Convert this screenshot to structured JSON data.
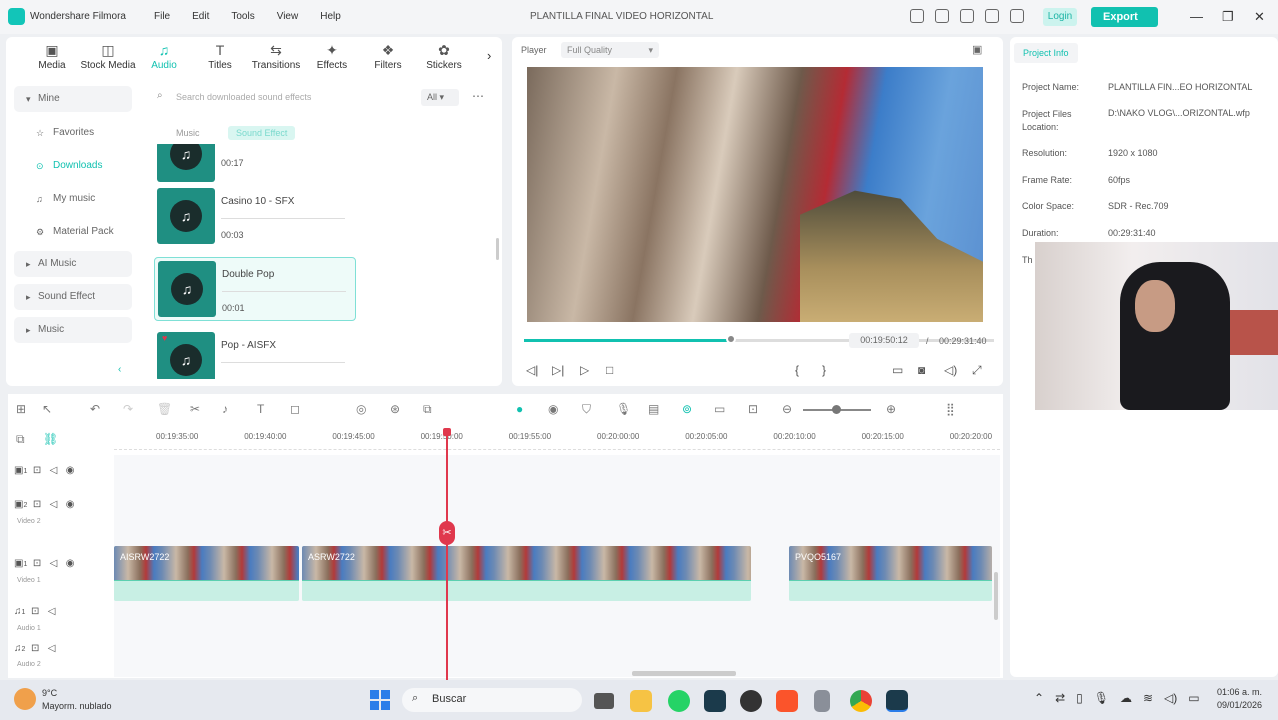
{
  "app": {
    "name": "Wondershare Filmora",
    "project_title": "PLANTILLA FINAL VIDEO HORIZONTAL",
    "login": "Login",
    "export": "Export"
  },
  "menu": [
    "File",
    "Edit",
    "Tools",
    "View",
    "Help"
  ],
  "tabs": [
    {
      "label": "Media",
      "icon": "media-icon"
    },
    {
      "label": "Stock Media",
      "icon": "stock-media-icon"
    },
    {
      "label": "Audio",
      "icon": "audio-icon"
    },
    {
      "label": "Titles",
      "icon": "titles-icon"
    },
    {
      "label": "Transitions",
      "icon": "transitions-icon"
    },
    {
      "label": "Effects",
      "icon": "effects-icon"
    },
    {
      "label": "Filters",
      "icon": "filters-icon"
    },
    {
      "label": "Stickers",
      "icon": "stickers-icon"
    }
  ],
  "sidebar": {
    "head": "Mine",
    "items": [
      "Favorites",
      "Downloads",
      "My music",
      "Material Pack"
    ],
    "sections": [
      "AI Music",
      "Sound Effect",
      "Music"
    ]
  },
  "search": {
    "placeholder": "Search downloaded sound effects",
    "filter": "All"
  },
  "subtabs": [
    "Music",
    "Sound Effect"
  ],
  "sounds": [
    {
      "name": "",
      "duration": "00:17"
    },
    {
      "name": "Casino 10 - SFX",
      "duration": "00:03"
    },
    {
      "name": "Double Pop",
      "duration": "00:01"
    },
    {
      "name": "Pop - AISFX",
      "duration": "00:01"
    }
  ],
  "player": {
    "label": "Player",
    "quality": "Full Quality",
    "current": "00:19:50:12",
    "total": "00:29:31:40",
    "sep": "/",
    "progress": 0.44
  },
  "project_info": {
    "tab": "Project Info",
    "rows": [
      {
        "k": "Project Name:",
        "v": "PLANTILLA FIN...EO HORIZONTAL"
      },
      {
        "k": "Project Files Location:",
        "v": "D:\\NAKO VLOG\\...ORIZONTAL.wfp"
      },
      {
        "k": "Resolution:",
        "v": "1920 x 1080"
      },
      {
        "k": "Frame Rate:",
        "v": "60fps"
      },
      {
        "k": "Color Space:",
        "v": "SDR - Rec.709"
      },
      {
        "k": "Duration:",
        "v": "00:29:31:40"
      },
      {
        "k": "Th",
        "v": ""
      }
    ]
  },
  "ruler": [
    "00:19:35:00",
    "00:19:40:00",
    "00:19:45:00",
    "00:19:50:00",
    "00:19:55:00",
    "00:20:00:00",
    "00:20:05:00",
    "00:20:10:00",
    "00:20:15:00",
    "00:20:20:00"
  ],
  "tracks": [
    {
      "num": "1",
      "label": ""
    },
    {
      "num": "2",
      "label": "Video 2"
    },
    {
      "num": "1",
      "label": "Video 1"
    },
    {
      "num": "1",
      "label": "Audio 1"
    },
    {
      "num": "2",
      "label": "Audio 2"
    }
  ],
  "clips": [
    "AISRW2722",
    "ASRW2722",
    "PVQO5167"
  ],
  "taskbar": {
    "temp": "9°C",
    "weather": "Mayorm. nublado",
    "search": "Buscar",
    "time": "01:06 a. m.",
    "date": "09/01/2026"
  }
}
